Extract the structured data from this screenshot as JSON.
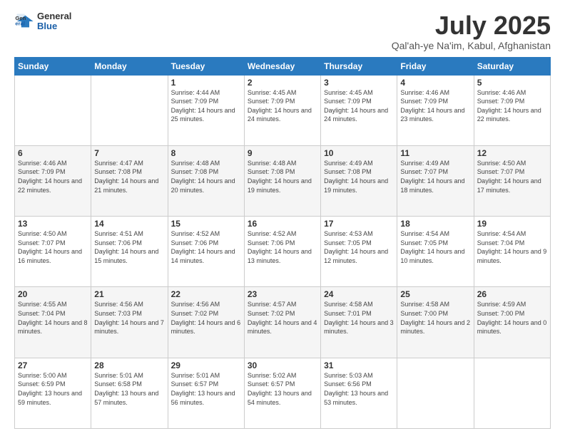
{
  "logo": {
    "general": "General",
    "blue": "Blue"
  },
  "title": "July 2025",
  "location": "Qal'ah-ye Na'im, Kabul, Afghanistan",
  "days_header": [
    "Sunday",
    "Monday",
    "Tuesday",
    "Wednesday",
    "Thursday",
    "Friday",
    "Saturday"
  ],
  "weeks": [
    [
      {
        "day": "",
        "info": ""
      },
      {
        "day": "",
        "info": ""
      },
      {
        "day": "1",
        "info": "Sunrise: 4:44 AM\nSunset: 7:09 PM\nDaylight: 14 hours and 25 minutes."
      },
      {
        "day": "2",
        "info": "Sunrise: 4:45 AM\nSunset: 7:09 PM\nDaylight: 14 hours and 24 minutes."
      },
      {
        "day": "3",
        "info": "Sunrise: 4:45 AM\nSunset: 7:09 PM\nDaylight: 14 hours and 24 minutes."
      },
      {
        "day": "4",
        "info": "Sunrise: 4:46 AM\nSunset: 7:09 PM\nDaylight: 14 hours and 23 minutes."
      },
      {
        "day": "5",
        "info": "Sunrise: 4:46 AM\nSunset: 7:09 PM\nDaylight: 14 hours and 22 minutes."
      }
    ],
    [
      {
        "day": "6",
        "info": "Sunrise: 4:46 AM\nSunset: 7:09 PM\nDaylight: 14 hours and 22 minutes."
      },
      {
        "day": "7",
        "info": "Sunrise: 4:47 AM\nSunset: 7:08 PM\nDaylight: 14 hours and 21 minutes."
      },
      {
        "day": "8",
        "info": "Sunrise: 4:48 AM\nSunset: 7:08 PM\nDaylight: 14 hours and 20 minutes."
      },
      {
        "day": "9",
        "info": "Sunrise: 4:48 AM\nSunset: 7:08 PM\nDaylight: 14 hours and 19 minutes."
      },
      {
        "day": "10",
        "info": "Sunrise: 4:49 AM\nSunset: 7:08 PM\nDaylight: 14 hours and 19 minutes."
      },
      {
        "day": "11",
        "info": "Sunrise: 4:49 AM\nSunset: 7:07 PM\nDaylight: 14 hours and 18 minutes."
      },
      {
        "day": "12",
        "info": "Sunrise: 4:50 AM\nSunset: 7:07 PM\nDaylight: 14 hours and 17 minutes."
      }
    ],
    [
      {
        "day": "13",
        "info": "Sunrise: 4:50 AM\nSunset: 7:07 PM\nDaylight: 14 hours and 16 minutes."
      },
      {
        "day": "14",
        "info": "Sunrise: 4:51 AM\nSunset: 7:06 PM\nDaylight: 14 hours and 15 minutes."
      },
      {
        "day": "15",
        "info": "Sunrise: 4:52 AM\nSunset: 7:06 PM\nDaylight: 14 hours and 14 minutes."
      },
      {
        "day": "16",
        "info": "Sunrise: 4:52 AM\nSunset: 7:06 PM\nDaylight: 14 hours and 13 minutes."
      },
      {
        "day": "17",
        "info": "Sunrise: 4:53 AM\nSunset: 7:05 PM\nDaylight: 14 hours and 12 minutes."
      },
      {
        "day": "18",
        "info": "Sunrise: 4:54 AM\nSunset: 7:05 PM\nDaylight: 14 hours and 10 minutes."
      },
      {
        "day": "19",
        "info": "Sunrise: 4:54 AM\nSunset: 7:04 PM\nDaylight: 14 hours and 9 minutes."
      }
    ],
    [
      {
        "day": "20",
        "info": "Sunrise: 4:55 AM\nSunset: 7:04 PM\nDaylight: 14 hours and 8 minutes."
      },
      {
        "day": "21",
        "info": "Sunrise: 4:56 AM\nSunset: 7:03 PM\nDaylight: 14 hours and 7 minutes."
      },
      {
        "day": "22",
        "info": "Sunrise: 4:56 AM\nSunset: 7:02 PM\nDaylight: 14 hours and 6 minutes."
      },
      {
        "day": "23",
        "info": "Sunrise: 4:57 AM\nSunset: 7:02 PM\nDaylight: 14 hours and 4 minutes."
      },
      {
        "day": "24",
        "info": "Sunrise: 4:58 AM\nSunset: 7:01 PM\nDaylight: 14 hours and 3 minutes."
      },
      {
        "day": "25",
        "info": "Sunrise: 4:58 AM\nSunset: 7:00 PM\nDaylight: 14 hours and 2 minutes."
      },
      {
        "day": "26",
        "info": "Sunrise: 4:59 AM\nSunset: 7:00 PM\nDaylight: 14 hours and 0 minutes."
      }
    ],
    [
      {
        "day": "27",
        "info": "Sunrise: 5:00 AM\nSunset: 6:59 PM\nDaylight: 13 hours and 59 minutes."
      },
      {
        "day": "28",
        "info": "Sunrise: 5:01 AM\nSunset: 6:58 PM\nDaylight: 13 hours and 57 minutes."
      },
      {
        "day": "29",
        "info": "Sunrise: 5:01 AM\nSunset: 6:57 PM\nDaylight: 13 hours and 56 minutes."
      },
      {
        "day": "30",
        "info": "Sunrise: 5:02 AM\nSunset: 6:57 PM\nDaylight: 13 hours and 54 minutes."
      },
      {
        "day": "31",
        "info": "Sunrise: 5:03 AM\nSunset: 6:56 PM\nDaylight: 13 hours and 53 minutes."
      },
      {
        "day": "",
        "info": ""
      },
      {
        "day": "",
        "info": ""
      }
    ]
  ]
}
